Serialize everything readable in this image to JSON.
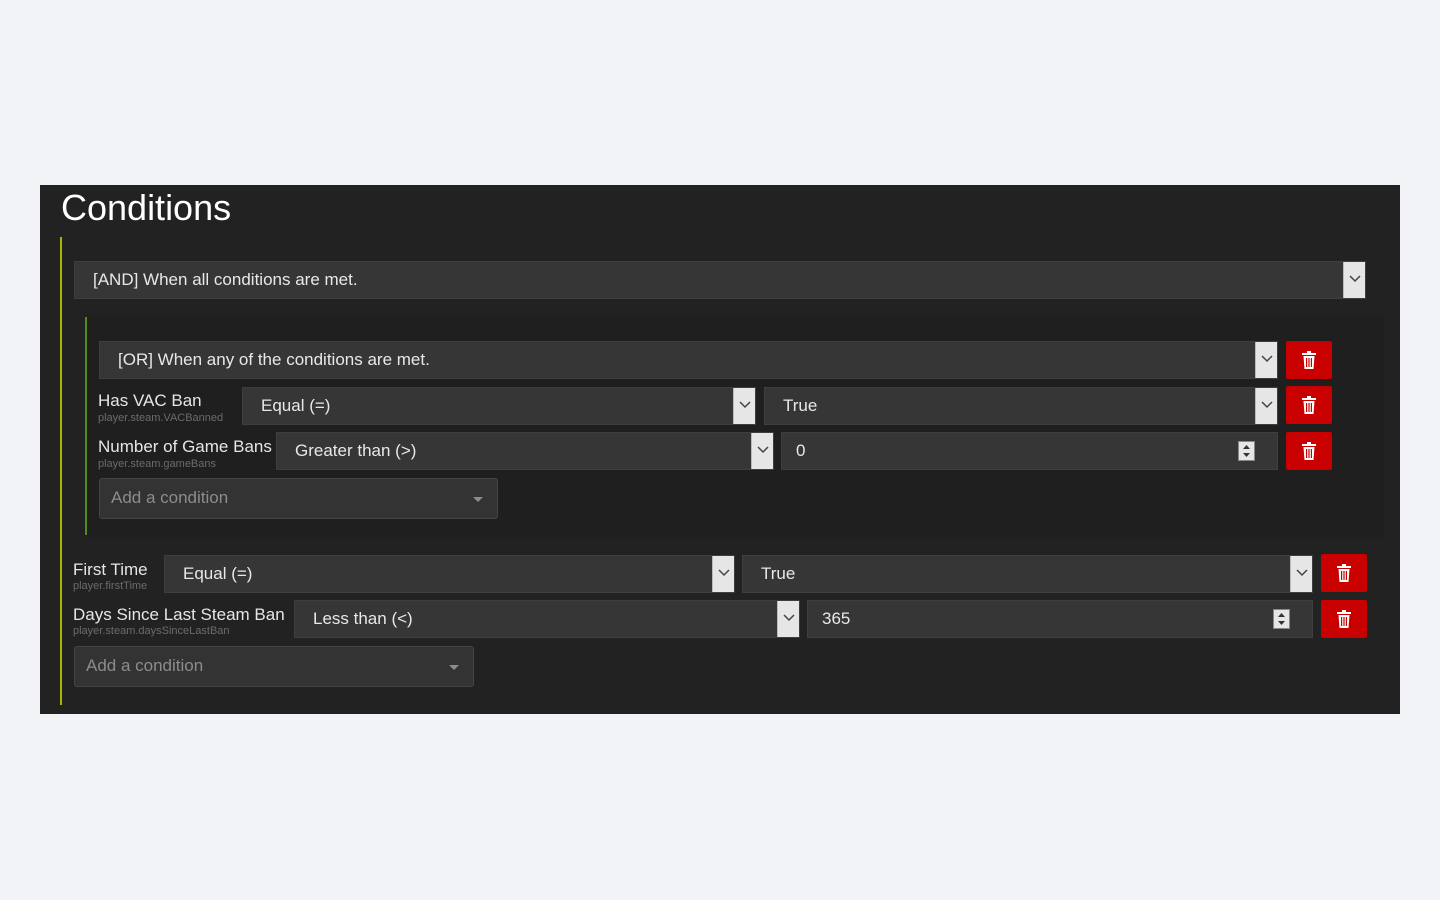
{
  "title": "Conditions",
  "root_group": {
    "mode": "[AND] When all conditions are met.",
    "nested_group": {
      "mode": "[OR] When any of the conditions are met.",
      "conditions": [
        {
          "label": "Has VAC Ban",
          "path": "player.steam.VACBanned",
          "operator": "Equal (=)",
          "value": "True"
        },
        {
          "label": "Number of Game Bans",
          "path": "player.steam.gameBans",
          "operator": "Greater than (>)",
          "value": "0"
        }
      ],
      "add_placeholder": "Add a condition"
    },
    "conditions": [
      {
        "label": "First Time",
        "path": "player.firstTime",
        "operator": "Equal (=)",
        "value": "True"
      },
      {
        "label": "Days Since Last Steam Ban",
        "path": "player.steam.daysSinceLastBan",
        "operator": "Less than (<)",
        "value": "365"
      }
    ],
    "add_placeholder": "Add a condition"
  },
  "colors": {
    "delete": "#c90000",
    "outer_line": "#a9b600",
    "inner_line": "#4d8f1a"
  }
}
